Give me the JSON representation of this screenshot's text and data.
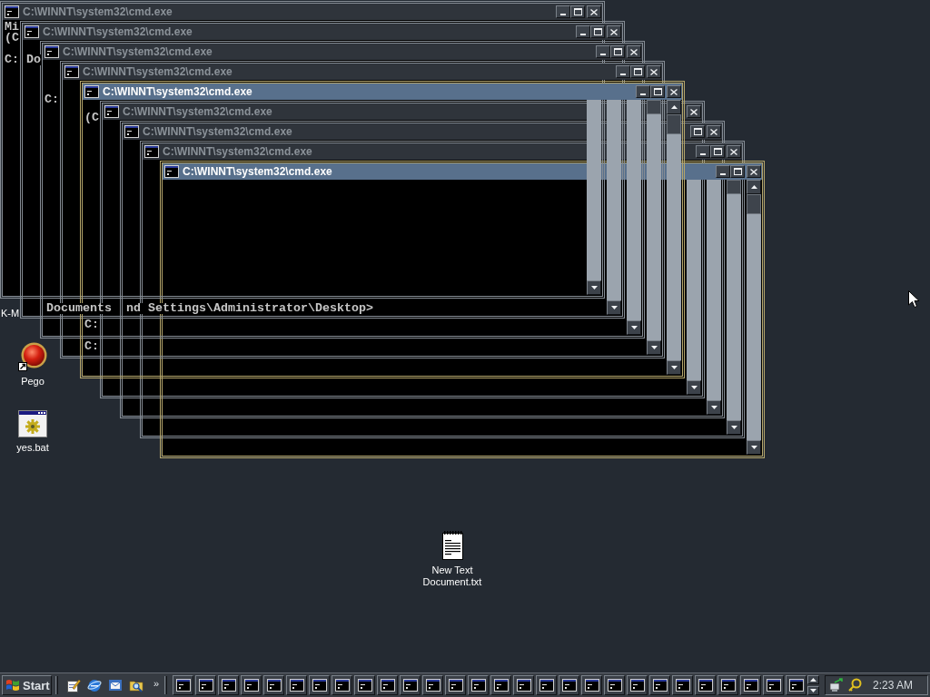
{
  "desktop_icons": [
    {
      "kind": "hidden",
      "label": "K-M"
    },
    {
      "kind": "shortcut",
      "label": "Pego"
    },
    {
      "kind": "batch",
      "label": "yes.bat"
    },
    {
      "kind": "text",
      "label": "New Text Document.txt"
    }
  ],
  "windows": [
    {
      "title": "C:\\WINNT\\system32\\cmd.exe",
      "active": false,
      "console": [
        "Mi",
        "(C",
        "C:",
        "Do"
      ]
    },
    {
      "title": "C:\\WINNT\\system32\\cmd.exe",
      "active": false,
      "console": [
        "Documents",
        "nd Settings\\Administrator\\Desktop>"
      ]
    },
    {
      "title": "C:\\WINNT\\system32\\cmd.exe",
      "active": false,
      "console": [
        "C:"
      ]
    },
    {
      "title": "C:\\WINNT\\system32\\cmd.exe",
      "active": false
    },
    {
      "title": "C:\\WINNT\\system32\\cmd.exe",
      "active": true,
      "console": [
        "(C",
        "C:",
        "C:"
      ]
    },
    {
      "title": "C:\\WINNT\\system32\\cmd.exe",
      "active": false
    },
    {
      "title": "C:\\WINNT\\system32\\cmd.exe",
      "active": false
    },
    {
      "title": "C:\\WINNT\\system32\\cmd.exe",
      "active": false
    },
    {
      "title": "C:\\WINNT\\system32\\cmd.exe",
      "active": true
    }
  ],
  "taskbar": {
    "start": "Start",
    "chevron": "»",
    "task_buttons": [
      {
        "selected": false
      },
      {
        "selected": false
      },
      {
        "selected": false
      },
      {
        "selected": false
      },
      {
        "selected": false
      },
      {
        "selected": false
      },
      {
        "selected": false
      },
      {
        "selected": false
      },
      {
        "selected": false
      },
      {
        "selected": false
      },
      {
        "selected": false
      },
      {
        "selected": false
      },
      {
        "selected": false
      },
      {
        "selected": false
      },
      {
        "selected": false
      },
      {
        "selected": false
      },
      {
        "selected": false
      },
      {
        "selected": false
      },
      {
        "selected": false
      },
      {
        "selected": false
      },
      {
        "selected": false
      },
      {
        "selected": false
      },
      {
        "selected": false
      },
      {
        "selected": false
      },
      {
        "selected": false
      },
      {
        "selected": false
      },
      {
        "selected": false
      },
      {
        "selected": false
      }
    ],
    "clock": "2:23 AM"
  }
}
